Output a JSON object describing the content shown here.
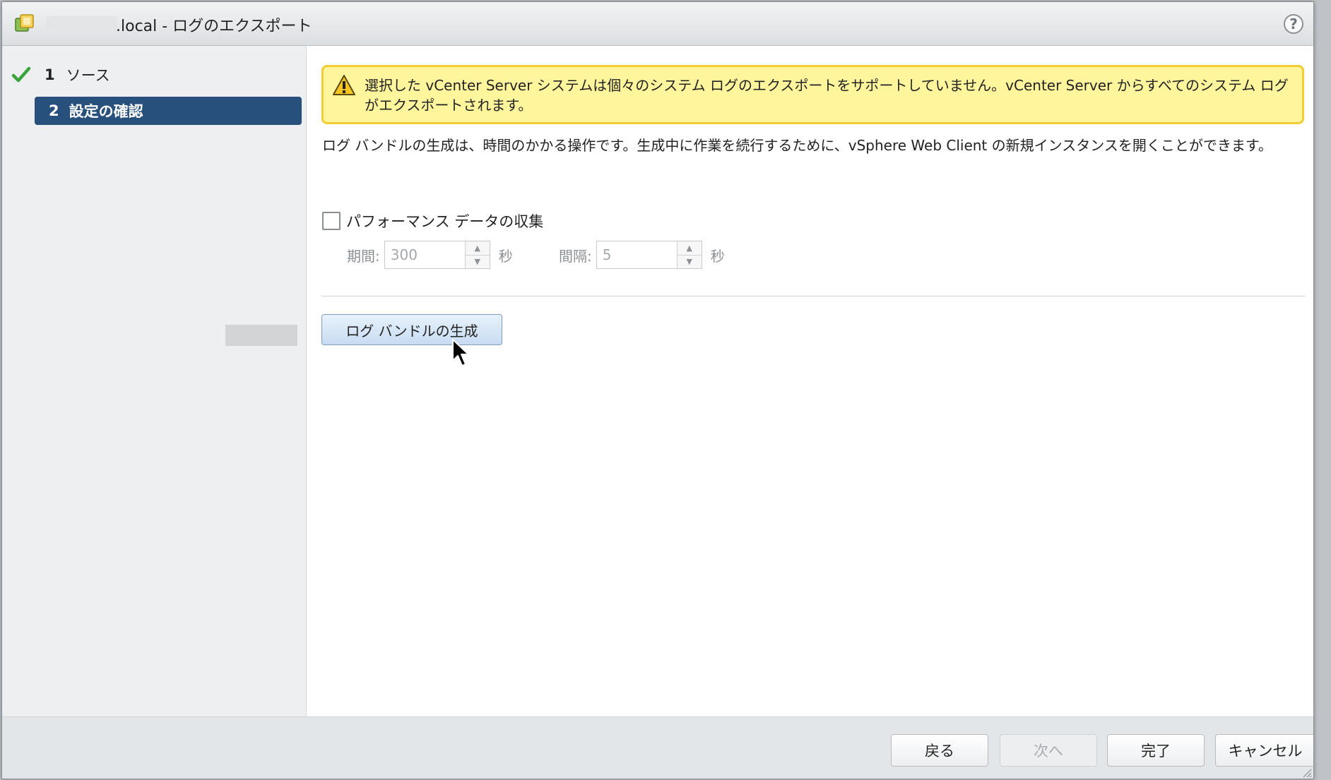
{
  "window": {
    "title": ".local - ログのエクスポート",
    "help_label": "?"
  },
  "wizard_steps": [
    {
      "number": "1",
      "label": "ソース",
      "status": "completed"
    },
    {
      "number": "2",
      "label": "設定の確認",
      "status": "active"
    }
  ],
  "warning": {
    "text": "選択した vCenter Server システムは個々のシステム ログのエクスポートをサポートしていません。vCenter Server からすべてのシステム ログがエクスポートされます。"
  },
  "description": "ログ バンドルの生成は、時間のかかる操作です。生成中に作業を続行するために、vSphere Web Client の新規インスタンスを開くことができます。",
  "performance": {
    "checkbox_label": "パフォーマンス データの収集",
    "checked": false,
    "duration": {
      "label": "期間:",
      "value": "300",
      "unit": "秒"
    },
    "interval": {
      "label": "間隔:",
      "value": "5",
      "unit": "秒"
    }
  },
  "generate_button_label": "ログ バンドルの生成",
  "footer": {
    "back_label": "戻る",
    "next_label": "次へ",
    "finish_label": "完了",
    "cancel_label": "キャンセル"
  },
  "colors": {
    "active_step": "#27507c",
    "warning_bg": "#fff59d",
    "warning_border": "#f2cc33",
    "check_green": "#3aa53a"
  }
}
